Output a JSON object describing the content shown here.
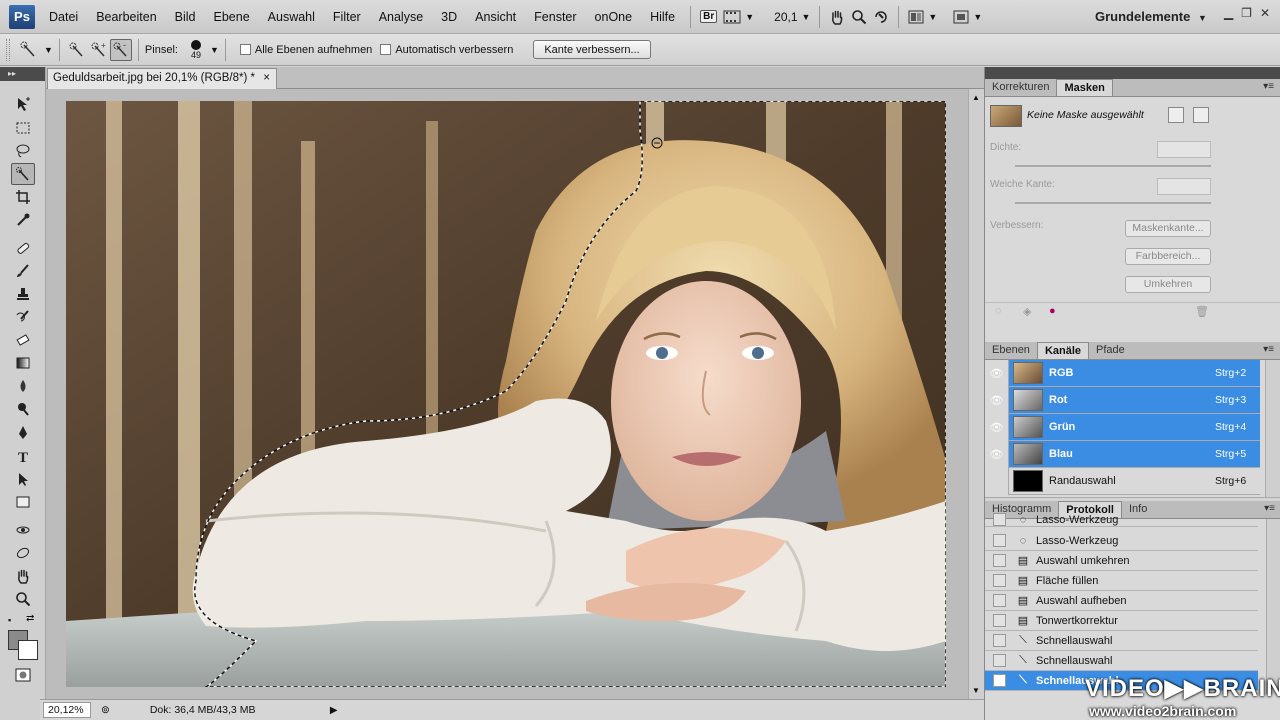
{
  "app": {
    "logo": "Ps",
    "workspace": "Grundelemente"
  },
  "menu": [
    "Datei",
    "Bearbeiten",
    "Bild",
    "Ebene",
    "Auswahl",
    "Filter",
    "Analyse",
    "3D",
    "Ansicht",
    "Fenster",
    "onOne",
    "Hilfe"
  ],
  "appbar": {
    "bridge": "Br",
    "zoom": "20,1"
  },
  "options": {
    "brush_label": "Pinsel:",
    "brush_size": "49",
    "all_layers": "Alle Ebenen aufnehmen",
    "auto_enhance": "Automatisch verbessern",
    "refine_edge_button": "Kante verbessern..."
  },
  "document": {
    "tab_title": "Geduldsarbeit.jpg bei 20,1% (RGB/8*) *",
    "close": "×"
  },
  "status": {
    "zoom": "20,12%",
    "doc": "Dok: 36,4 MB/43,3 MB"
  },
  "masks_panel": {
    "tabs": [
      "Korrekturen",
      "Masken"
    ],
    "no_mask": "Keine Maske ausgewählt",
    "density": "Dichte:",
    "feather": "Weiche Kante:",
    "refine": "Verbessern:",
    "btn_mask_edge": "Maskenkante...",
    "btn_color_range": "Farbbereich...",
    "btn_invert": "Umkehren"
  },
  "channels_panel": {
    "tabs": [
      "Ebenen",
      "Kanäle",
      "Pfade"
    ],
    "channels": [
      {
        "name": "RGB",
        "shortcut": "Strg+2"
      },
      {
        "name": "Rot",
        "shortcut": "Strg+3"
      },
      {
        "name": "Grün",
        "shortcut": "Strg+4"
      },
      {
        "name": "Blau",
        "shortcut": "Strg+5"
      },
      {
        "name": "Randauswahl",
        "shortcut": "Strg+6"
      }
    ]
  },
  "history_panel": {
    "tabs": [
      "Histogramm",
      "Protokoll",
      "Info"
    ],
    "items": [
      "Lasso-Werkzeug",
      "Lasso-Werkzeug",
      "Auswahl umkehren",
      "Fläche füllen",
      "Auswahl aufheben",
      "Tonwertkorrektur",
      "Schnellauswahl",
      "Schnellauswahl",
      "Schnellauswahl"
    ]
  },
  "watermark": {
    "brand": "VIDEO▶▶BRAIN",
    "url": "www.video2brain.com"
  },
  "colors": {
    "selection": "#3b8de4",
    "panel_bg": "#d9d9d9",
    "dock_header": "#4b4b4b"
  }
}
